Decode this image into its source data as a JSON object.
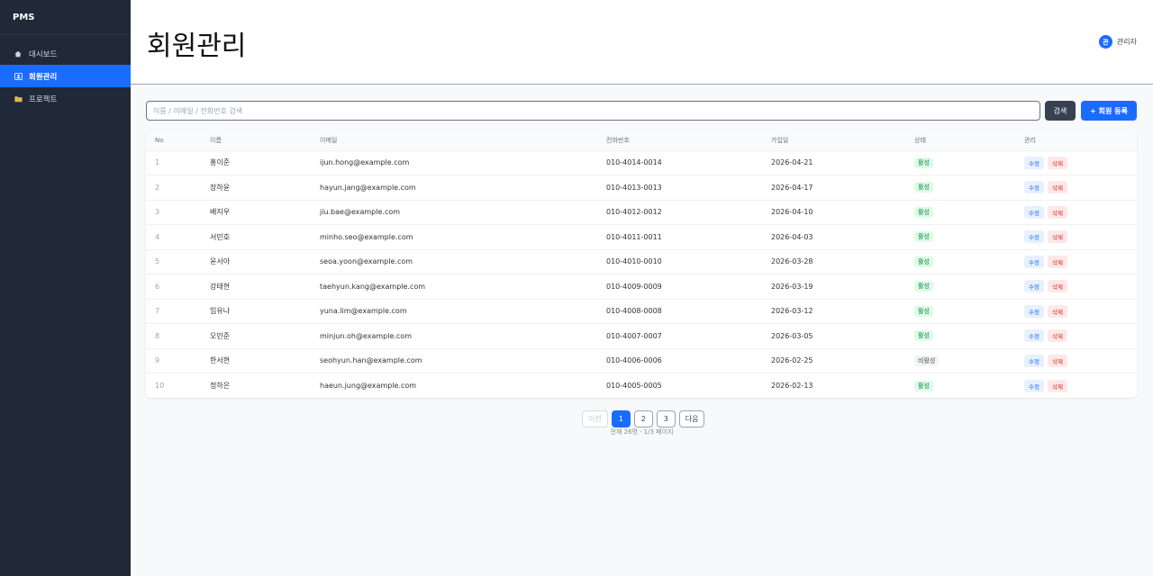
{
  "brand": "PMS",
  "nav": [
    {
      "label": "대시보드",
      "icon": "home-icon",
      "active": false
    },
    {
      "label": "회원관리",
      "icon": "members-icon",
      "active": true
    },
    {
      "label": "프로젝트",
      "icon": "folder-icon",
      "active": false
    }
  ],
  "header": {
    "title": "회원관리",
    "avatar_initial": "관",
    "user_name": "관리자"
  },
  "search": {
    "placeholder": "이름 / 이메일 / 전화번호 검색",
    "value": "",
    "search_label": "검색",
    "add_label": "+ 회원 등록"
  },
  "table": {
    "columns": [
      "No",
      "이름",
      "이메일",
      "전화번호",
      "가입일",
      "상태",
      "관리"
    ],
    "edit_label": "수정",
    "delete_label": "삭제",
    "rows": [
      {
        "no": "1",
        "name": "홍이준",
        "email": "ijun.hong@example.com",
        "phone": "010-4014-0014",
        "joined": "2026-04-21",
        "status": "활성",
        "active": true
      },
      {
        "no": "2",
        "name": "장하윤",
        "email": "hayun.jang@example.com",
        "phone": "010-4013-0013",
        "joined": "2026-04-17",
        "status": "활성",
        "active": true
      },
      {
        "no": "3",
        "name": "배지우",
        "email": "jiu.bae@example.com",
        "phone": "010-4012-0012",
        "joined": "2026-04-10",
        "status": "활성",
        "active": true
      },
      {
        "no": "4",
        "name": "서민호",
        "email": "minho.seo@example.com",
        "phone": "010-4011-0011",
        "joined": "2026-04-03",
        "status": "활성",
        "active": true
      },
      {
        "no": "5",
        "name": "윤서아",
        "email": "seoa.yoon@example.com",
        "phone": "010-4010-0010",
        "joined": "2026-03-28",
        "status": "활성",
        "active": true
      },
      {
        "no": "6",
        "name": "강태현",
        "email": "taehyun.kang@example.com",
        "phone": "010-4009-0009",
        "joined": "2026-03-19",
        "status": "활성",
        "active": true
      },
      {
        "no": "7",
        "name": "임유나",
        "email": "yuna.lim@example.com",
        "phone": "010-4008-0008",
        "joined": "2026-03-12",
        "status": "활성",
        "active": true
      },
      {
        "no": "8",
        "name": "오민준",
        "email": "minjun.oh@example.com",
        "phone": "010-4007-0007",
        "joined": "2026-03-05",
        "status": "활성",
        "active": true
      },
      {
        "no": "9",
        "name": "한서현",
        "email": "seohyun.han@example.com",
        "phone": "010-4006-0006",
        "joined": "2026-02-25",
        "status": "비활성",
        "active": false
      },
      {
        "no": "10",
        "name": "정하은",
        "email": "haeun.jung@example.com",
        "phone": "010-4005-0005",
        "joined": "2026-02-13",
        "status": "활성",
        "active": true
      }
    ]
  },
  "pagination": {
    "prev_label": "이전",
    "next_label": "다음",
    "pages": [
      "1",
      "2",
      "3"
    ],
    "current": "1",
    "info": "전체 26명 · 1/3 페이지"
  },
  "colors": {
    "accent": "#1a6cff",
    "sidebar": "#1f2937"
  }
}
